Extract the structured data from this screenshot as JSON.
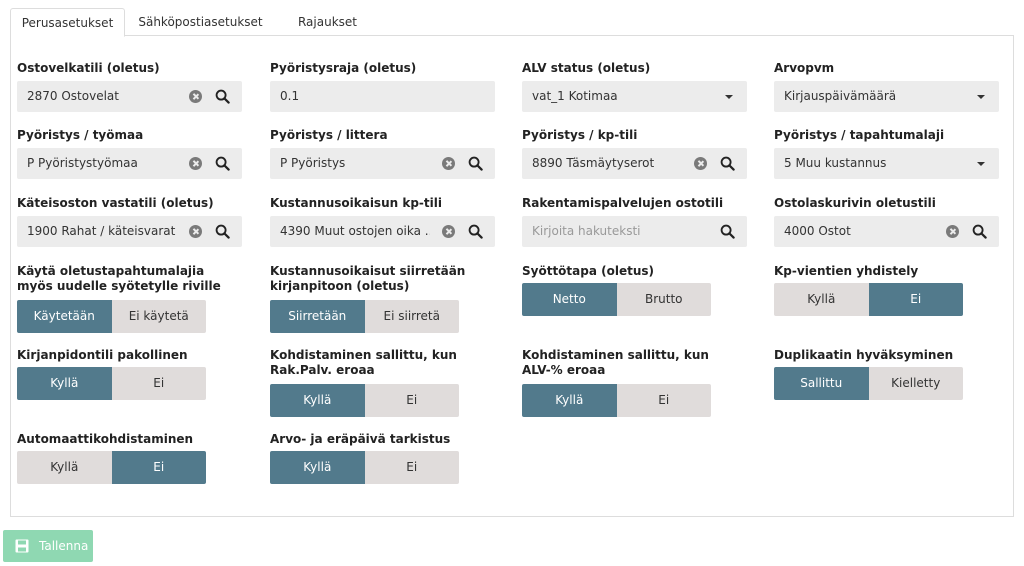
{
  "tabs": [
    "Perusasetukset",
    "Sähköpostiasetukset",
    "Rajaukset"
  ],
  "fields": {
    "ostovelkatili": {
      "label": "Ostovelkatili (oletus)",
      "value": "2870 Ostovelat"
    },
    "pyoristysraja": {
      "label": "Pyöristysraja (oletus)",
      "value": "0.1"
    },
    "alv_status": {
      "label": "ALV status (oletus)",
      "value": "vat_1 Kotimaa"
    },
    "arvopvm": {
      "label": "Arvopvm",
      "value": "Kirjauspäivämäärä"
    },
    "pyoristys_tyomaa": {
      "label": "Pyöristys / työmaa",
      "value": "P Pyöristystyömaa"
    },
    "pyoristys_littera": {
      "label": "Pyöristys / littera",
      "value": "P Pyöristys"
    },
    "pyoristys_kptili": {
      "label": "Pyöristys / kp-tili",
      "value": "8890 Täsmäytyserot"
    },
    "pyoristys_tapahtumalaji": {
      "label": "Pyöristys / tapahtumalaji",
      "value": "5 Muu kustannus"
    },
    "kateisoston_vastatili": {
      "label": "Käteisoston vastatili (oletus)",
      "value": "1900 Rahat / käteisvarat"
    },
    "kustannusoikaisun_kptili": {
      "label": "Kustannusoikaisun kp-tili",
      "value": "4390 Muut ostojen oika ..."
    },
    "rakentamispalvelujen_ostotili": {
      "label": "Rakentamispalvelujen ostotili",
      "value": "",
      "placeholder": "Kirjoita hakuteksti"
    },
    "ostolaskurivin_oletustili": {
      "label": "Ostolaskurivin oletustili",
      "value": "4000 Ostot"
    }
  },
  "toggles": {
    "kayta_oletus": {
      "label": "Käytä oletustapahtumalajia myös uudelle syötetylle riville",
      "options": [
        "Käytetään",
        "Ei käytetä"
      ],
      "selected": 0
    },
    "kustannusoikaisut": {
      "label": "Kustannusoikaisut siirretään kirjanpitoon (oletus)",
      "options": [
        "Siirretään",
        "Ei siirretä"
      ],
      "selected": 0
    },
    "syottotapa": {
      "label": "Syöttötapa (oletus)",
      "options": [
        "Netto",
        "Brutto"
      ],
      "selected": 0
    },
    "kp_vientien": {
      "label": "Kp-vientien yhdistely",
      "options": [
        "Kyllä",
        "Ei"
      ],
      "selected": 1
    },
    "kirjanpitotili": {
      "label": "Kirjanpidontili pakollinen",
      "options": [
        "Kyllä",
        "Ei"
      ],
      "selected": 0
    },
    "kohdistaminen_rak": {
      "label": "Kohdistaminen sallittu, kun Rak.Palv. eroaa",
      "options": [
        "Kyllä",
        "Ei"
      ],
      "selected": 0
    },
    "kohdistaminen_alv": {
      "label": "Kohdistaminen sallittu, kun ALV-% eroaa",
      "options": [
        "Kyllä",
        "Ei"
      ],
      "selected": 0
    },
    "duplikaatin": {
      "label": "Duplikaatin hyväksyminen",
      "options": [
        "Sallittu",
        "Kielletty"
      ],
      "selected": 0
    },
    "automaatti": {
      "label": "Automaattikohdistaminen",
      "options": [
        "Kyllä",
        "Ei"
      ],
      "selected": 1
    },
    "arvo_erapaiva": {
      "label": "Arvo- ja eräpäivä tarkistus",
      "options": [
        "Kyllä",
        "Ei"
      ],
      "selected": 0
    }
  },
  "save_label": "Tallenna",
  "colors": {
    "toggle_on": "#527a8c",
    "toggle_off": "#e0dcdb",
    "field_bg": "#ececec",
    "save_bg": "#8fd8b2"
  }
}
